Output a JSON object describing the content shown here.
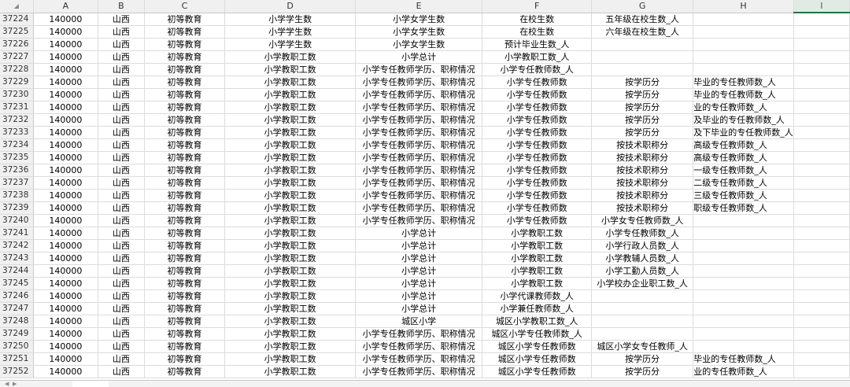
{
  "columns": [
    "",
    "A",
    "B",
    "C",
    "D",
    "E",
    "F",
    "G",
    "H",
    "I"
  ],
  "corner_icon": "select-all-triangle",
  "accent": "#217346",
  "rows": [
    [
      "37224",
      "140000",
      "山西",
      "初等教育",
      "小学学生数",
      "小学女学生数",
      "在校生数",
      "五年级在校生数_人",
      ""
    ],
    [
      "37225",
      "140000",
      "山西",
      "初等教育",
      "小学学生数",
      "小学女学生数",
      "在校生数",
      "六年级在校生数_人",
      ""
    ],
    [
      "37226",
      "140000",
      "山西",
      "初等教育",
      "小学学生数",
      "小学女学生数",
      "预计毕业生数_人",
      "",
      ""
    ],
    [
      "37227",
      "140000",
      "山西",
      "初等教育",
      "小学教职工数",
      "小学总计",
      "小学教职工数_人",
      "",
      ""
    ],
    [
      "37228",
      "140000",
      "山西",
      "初等教育",
      "小学教职工数",
      "小学专任教师学历、职称情况",
      "小学专任教师数_人",
      "",
      ""
    ],
    [
      "37229",
      "140000",
      "山西",
      "初等教育",
      "小学教职工数",
      "小学专任教师学历、职称情况",
      "小学专任教师数",
      "按学历分",
      "毕业的专任教师数_人"
    ],
    [
      "37230",
      "140000",
      "山西",
      "初等教育",
      "小学教职工数",
      "小学专任教师学历、职称情况",
      "小学专任教师数",
      "按学历分",
      "毕业的专任教师数_人"
    ],
    [
      "37231",
      "140000",
      "山西",
      "初等教育",
      "小学教职工数",
      "小学专任教师学历、职称情况",
      "小学专任教师数",
      "按学历分",
      "业的专任教师数_人"
    ],
    [
      "37232",
      "140000",
      "山西",
      "初等教育",
      "小学教职工数",
      "小学专任教师学历、职称情况",
      "小学专任教师数",
      "按学历分",
      "及毕业的专任教师数_人"
    ],
    [
      "37233",
      "140000",
      "山西",
      "初等教育",
      "小学教职工数",
      "小学专任教师学历、职称情况",
      "小学专任教师数",
      "按学历分",
      "及下毕业的专任教师数_人"
    ],
    [
      "37234",
      "140000",
      "山西",
      "初等教育",
      "小学教职工数",
      "小学专任教师学历、职称情况",
      "小学专任教师数",
      "按技术职称分",
      "高级专任教师数_人"
    ],
    [
      "37235",
      "140000",
      "山西",
      "初等教育",
      "小学教职工数",
      "小学专任教师学历、职称情况",
      "小学专任教师数",
      "按技术职称分",
      "高级专任教师数_人"
    ],
    [
      "37236",
      "140000",
      "山西",
      "初等教育",
      "小学教职工数",
      "小学专任教师学历、职称情况",
      "小学专任教师数",
      "按技术职称分",
      "一级专任教师数_人"
    ],
    [
      "37237",
      "140000",
      "山西",
      "初等教育",
      "小学教职工数",
      "小学专任教师学历、职称情况",
      "小学专任教师数",
      "按技术职称分",
      "二级专任教师数_人"
    ],
    [
      "37238",
      "140000",
      "山西",
      "初等教育",
      "小学教职工数",
      "小学专任教师学历、职称情况",
      "小学专任教师数",
      "按技术职称分",
      "三级专任教师数_人"
    ],
    [
      "37239",
      "140000",
      "山西",
      "初等教育",
      "小学教职工数",
      "小学专任教师学历、职称情况",
      "小学专任教师数",
      "按技术职称分",
      "职级专任教师数_人"
    ],
    [
      "37240",
      "140000",
      "山西",
      "初等教育",
      "小学教职工数",
      "小学专任教师学历、职称情况",
      "小学专任教师数",
      "小学女专任教师数_人",
      ""
    ],
    [
      "37241",
      "140000",
      "山西",
      "初等教育",
      "小学教职工数",
      "小学总计",
      "小学教职工数",
      "小学专任教师数_人",
      ""
    ],
    [
      "37242",
      "140000",
      "山西",
      "初等教育",
      "小学教职工数",
      "小学总计",
      "小学教职工数",
      "小学行政人员数_人",
      ""
    ],
    [
      "37243",
      "140000",
      "山西",
      "初等教育",
      "小学教职工数",
      "小学总计",
      "小学教职工数",
      "小学教辅人员数_人",
      ""
    ],
    [
      "37244",
      "140000",
      "山西",
      "初等教育",
      "小学教职工数",
      "小学总计",
      "小学教职工数",
      "小学工勤人员数_人",
      ""
    ],
    [
      "37245",
      "140000",
      "山西",
      "初等教育",
      "小学教职工数",
      "小学总计",
      "小学教职工数",
      "小学校办企业职工数_人",
      ""
    ],
    [
      "37246",
      "140000",
      "山西",
      "初等教育",
      "小学教职工数",
      "小学总计",
      "小学代课教师数_人",
      "",
      ""
    ],
    [
      "37247",
      "140000",
      "山西",
      "初等教育",
      "小学教职工数",
      "小学总计",
      "小学兼任教师数_人",
      "",
      ""
    ],
    [
      "37248",
      "140000",
      "山西",
      "初等教育",
      "小学教职工数",
      "城区小学",
      "城区小学教职工数_人",
      "",
      ""
    ],
    [
      "37249",
      "140000",
      "山西",
      "初等教育",
      "小学教职工数",
      "小学专任教师学历、职称情况",
      "城区小学专任教师数_人",
      "",
      ""
    ],
    [
      "37250",
      "140000",
      "山西",
      "初等教育",
      "小学教职工数",
      "小学专任教师学历、职称情况",
      "城区小学专任教师数",
      "城区小学女专任教师_人",
      ""
    ],
    [
      "37251",
      "140000",
      "山西",
      "初等教育",
      "小学教职工数",
      "小学专任教师学历、职称情况",
      "城区小学专任教师数",
      "按学历分",
      "毕业的专任教师数_人"
    ],
    [
      "37252",
      "140000",
      "山西",
      "初等教育",
      "小学教职工数",
      "小学专任教师学历、职称情况",
      "城区小学专任教师数",
      "按学历分",
      "业的专任教师数_人"
    ]
  ]
}
